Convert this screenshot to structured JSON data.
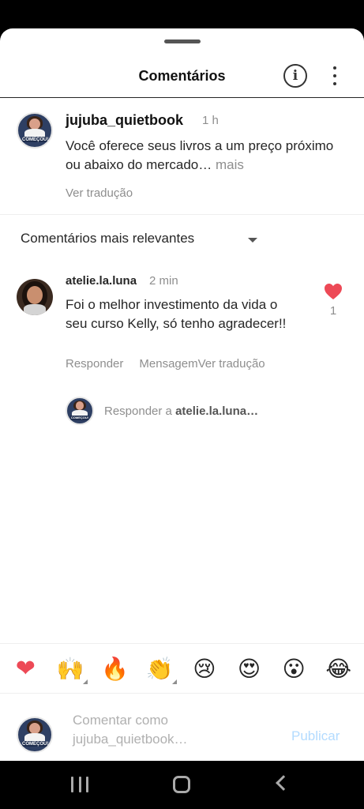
{
  "header": {
    "title": "Comentários"
  },
  "caption": {
    "username": "jujuba_quietbook",
    "time": "1 h",
    "text": "Você oferece seus livros a um preço próximo ou abaixo do mercado…",
    "more_label": " mais",
    "translate_label": "Ver tradução",
    "avatar_tag": "COMEÇOU!"
  },
  "filter": {
    "label": "Comentários mais relevantes"
  },
  "comment": {
    "username": "atelie.la.luna",
    "time": "2 min",
    "text": "Foi o melhor investimento da vida o seu curso Kelly, só tenho agradecer!!",
    "reply_label": "Responder",
    "message_label": "Mensagem",
    "translate_label": "Ver tradução",
    "like_count": "1"
  },
  "reply": {
    "prefix": "Responder a ",
    "target": "atelie.la.luna…"
  },
  "emoji_bar": {
    "items": [
      "❤",
      "🙌",
      "🔥",
      "👏",
      "😢",
      "😍",
      "😮",
      "😂"
    ]
  },
  "composer": {
    "placeholder": "Comentar como jujuba_quietbook…",
    "publish_label": "Publicar"
  },
  "colors": {
    "like": "#ed4956",
    "publish_disabled": "#b3dbff",
    "secondary_text": "#8e8e8e"
  }
}
